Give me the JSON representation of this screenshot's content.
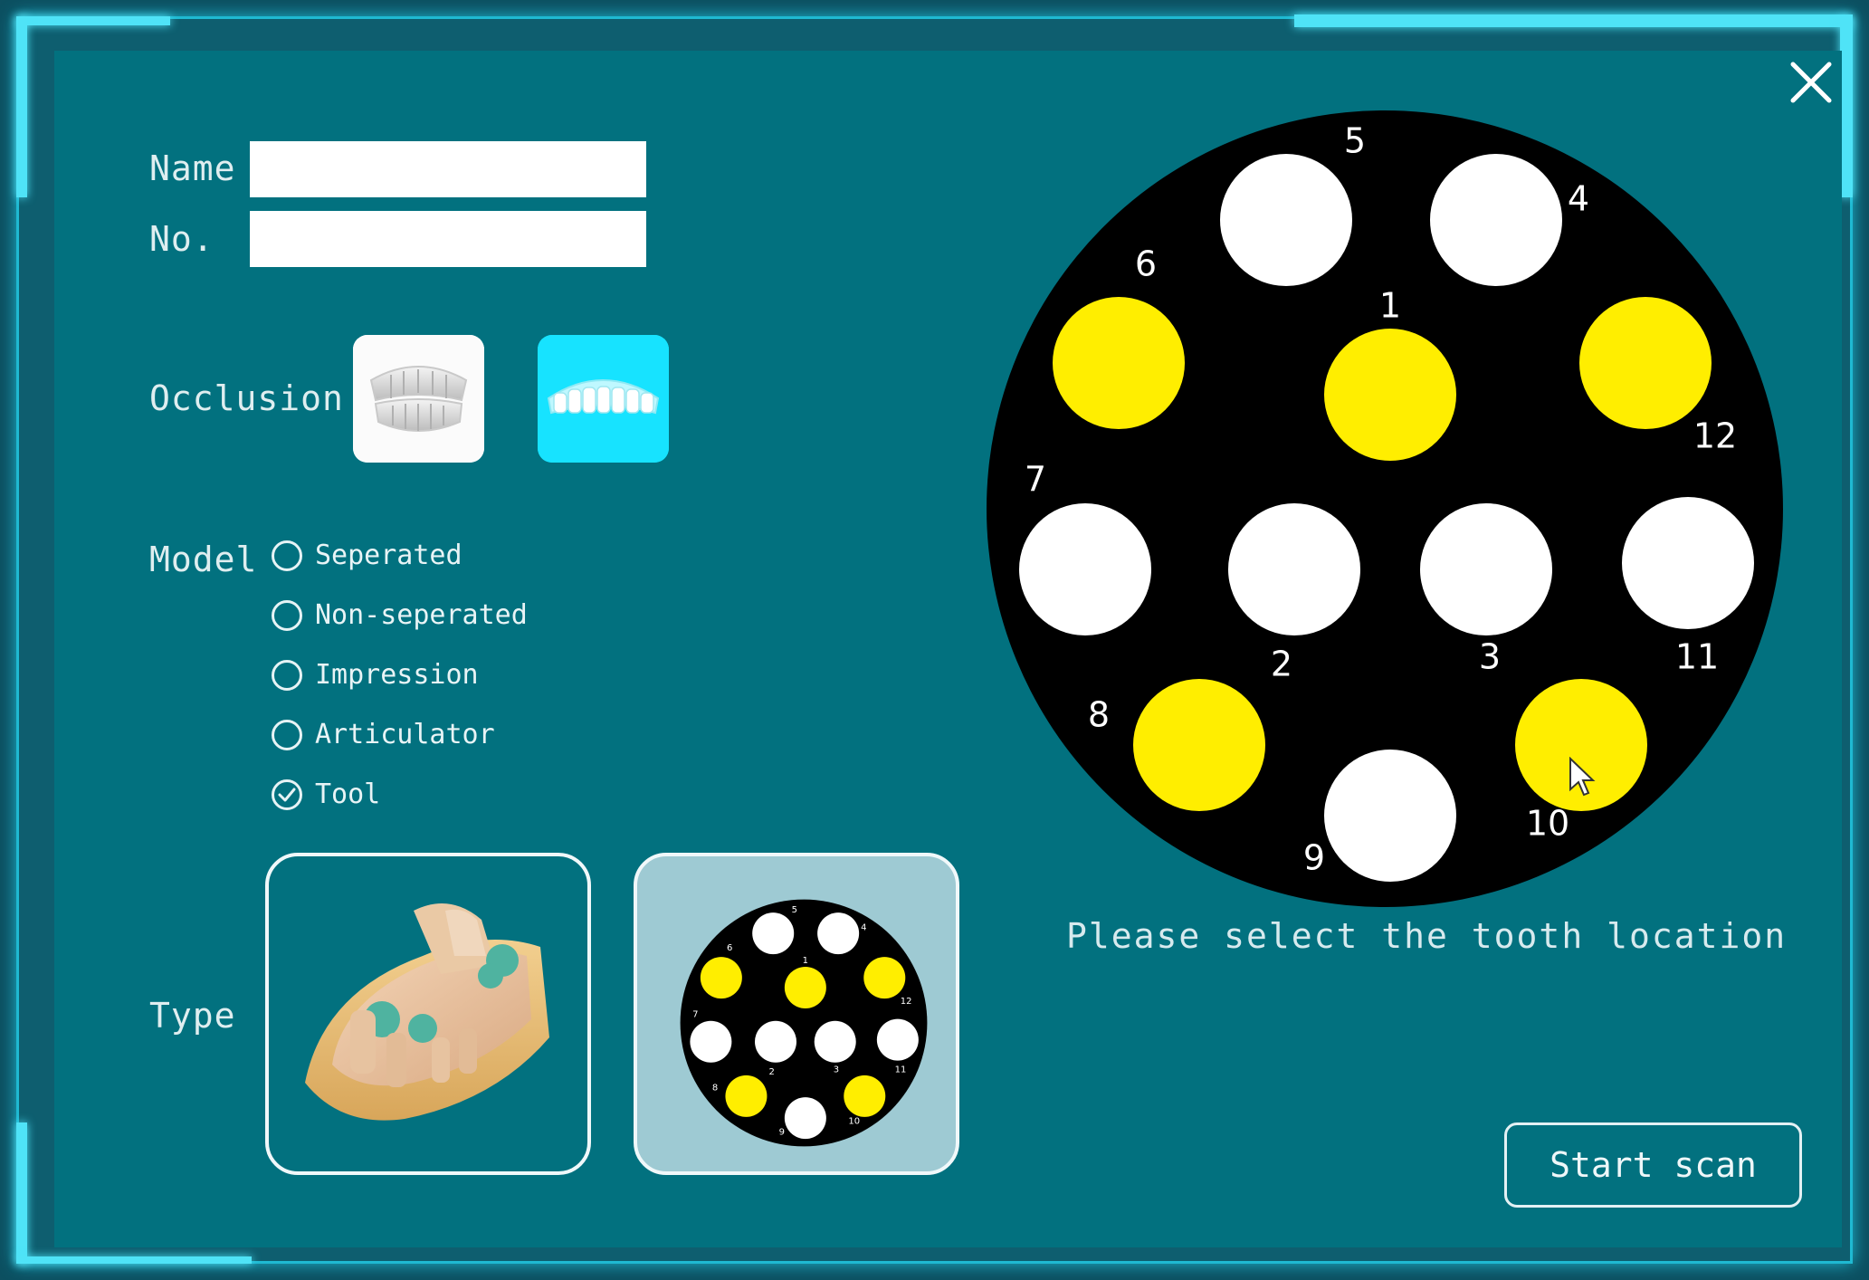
{
  "form": {
    "name_label": "Name",
    "name_value": "",
    "no_label": "No.",
    "no_value": "",
    "occlusion_label": "Occlusion",
    "occlusion_options": [
      {
        "icon": "full-dentition-icon",
        "selected": false
      },
      {
        "icon": "upper-arch-icon",
        "selected": true
      }
    ],
    "model_label": "Model",
    "model_options": [
      {
        "label": "Seperated",
        "checked": false
      },
      {
        "label": "Non-seperated",
        "checked": false
      },
      {
        "label": "Impression",
        "checked": false
      },
      {
        "label": "Articulator",
        "checked": false
      },
      {
        "label": "Tool",
        "checked": true
      }
    ],
    "type_label": "Type",
    "type_options": [
      {
        "icon": "dental-model-icon",
        "selected": false
      },
      {
        "icon": "tooth-plate-icon",
        "selected": true
      }
    ]
  },
  "tooth_plate": {
    "slots": [
      {
        "label": "1",
        "selected": true
      },
      {
        "label": "2",
        "selected": false
      },
      {
        "label": "3",
        "selected": false
      },
      {
        "label": "4",
        "selected": false
      },
      {
        "label": "5",
        "selected": false
      },
      {
        "label": "6",
        "selected": true
      },
      {
        "label": "7",
        "selected": false
      },
      {
        "label": "8",
        "selected": true
      },
      {
        "label": "9",
        "selected": false
      },
      {
        "label": "10",
        "selected": true
      },
      {
        "label": "11",
        "selected": false
      },
      {
        "label": "12",
        "selected": true
      }
    ],
    "hint": "Please select the tooth location"
  },
  "actions": {
    "start_label": "Start scan",
    "close_icon": "close-icon"
  },
  "colors": {
    "selected": "#ffee00",
    "unselected": "#ffffff",
    "plate": "#000000",
    "accent": "#00e4ff"
  }
}
